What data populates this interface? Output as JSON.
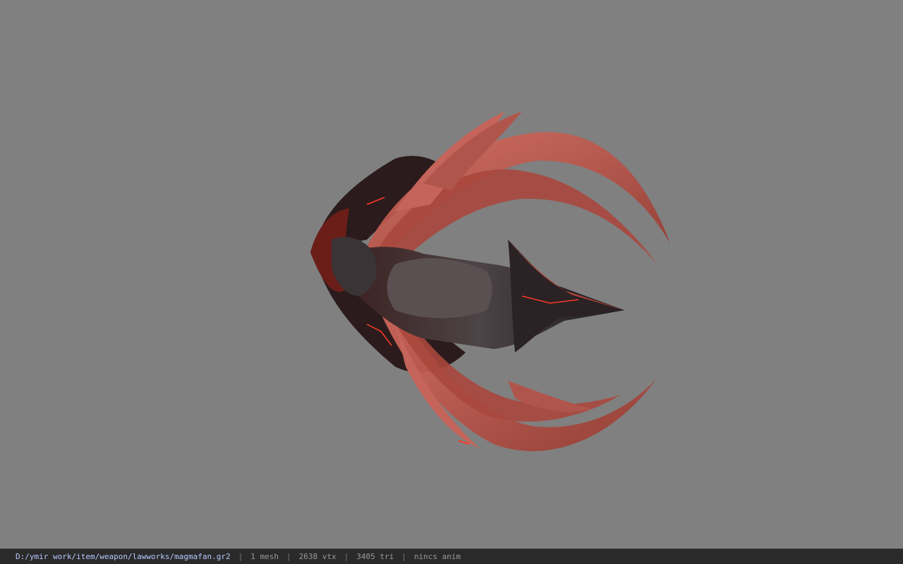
{
  "viewer": {
    "background_color": "#808080",
    "model_colors": {
      "blade": "#c85a4e",
      "blade_dark": "#8a3028",
      "core": "#2b2628",
      "core_mid": "#4a3a3c",
      "glow": "#ff3a2a"
    }
  },
  "statusbar": {
    "file_path": "D:/ymir work/item/weapon/lawworks/magmafan.gr2",
    "mesh_count": "1 mesh",
    "vertex_count": "2638 vtx",
    "triangle_count": "3405 tri",
    "animation": "nincs anim",
    "separator": "|"
  }
}
